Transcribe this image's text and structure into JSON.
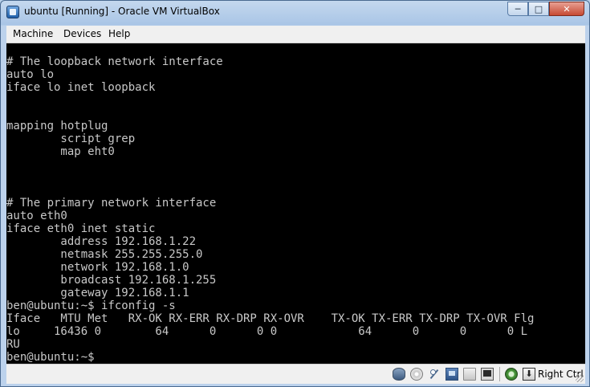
{
  "window": {
    "title": "ubuntu [Running] - Oracle VM VirtualBox",
    "controls": {
      "minimize": "─",
      "maximize": "□",
      "close": "✕"
    }
  },
  "menu": [
    {
      "label": "Machine"
    },
    {
      "label": "Devices"
    },
    {
      "label": "Help"
    }
  ],
  "terminal": {
    "lines": [
      "# The loopback network interface",
      "auto lo",
      "iface lo inet loopback",
      "",
      "",
      "mapping hotplug",
      "        script grep",
      "        map eht0",
      "",
      "",
      "",
      "# The primary network interface",
      "auto eth0",
      "iface eth0 inet static",
      "        address 192.168.1.22",
      "        netmask 255.255.255.0",
      "        network 192.168.1.0",
      "        broadcast 192.168.1.255",
      "        gateway 192.168.1.1",
      "ben@ubuntu:~$ ifconfig -s",
      "Iface   MTU Met   RX-OK RX-ERR RX-DRP RX-OVR    TX-OK TX-ERR TX-DRP TX-OVR Flg",
      "lo     16436 0        64      0      0 0            64      0      0      0 L",
      "RU",
      "ben@ubuntu:~$"
    ]
  },
  "statusbar": {
    "icons": [
      "hard-disk-icon",
      "optical-drive-icon",
      "usb-icon",
      "network-icon",
      "shared-folders-icon",
      "remote-display-icon",
      "virtualization-icon",
      "host-key-icon"
    ],
    "host_key_glyph": "⬇",
    "host_key_label": "Right Ctrl"
  },
  "colors": {
    "terminal_bg": "#000000",
    "terminal_fg": "#c8c8c8",
    "frame": "#bcd2ec",
    "close_button": "#c74a32"
  }
}
